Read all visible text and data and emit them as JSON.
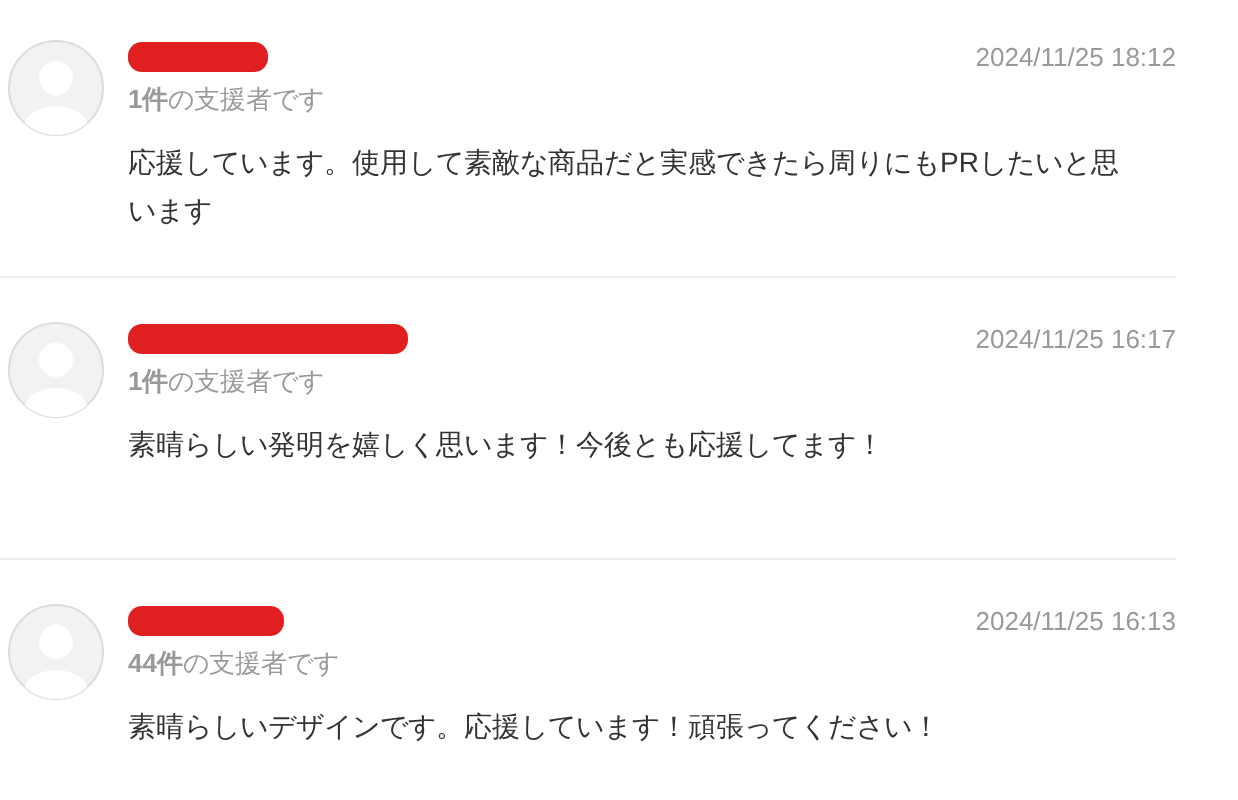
{
  "comments": [
    {
      "supporter": "**1件**の支援者です",
      "date": "2024/11/25 18:12",
      "text": "応援しています。使用して素敵な商品だと実感できたら周りにもPRしたいと思います"
    },
    {
      "supporter": "**1件**の支援者です",
      "date": "2024/11/25 16:17",
      "text": "素晴らしい発明を嬉しく思います！今後とも応援してます！"
    },
    {
      "supporter": "**44件**の支援者です",
      "date": "2024/11/25 16:13",
      "text": "素晴らしいデザインです。応援しています！頑張ってください！"
    }
  ]
}
